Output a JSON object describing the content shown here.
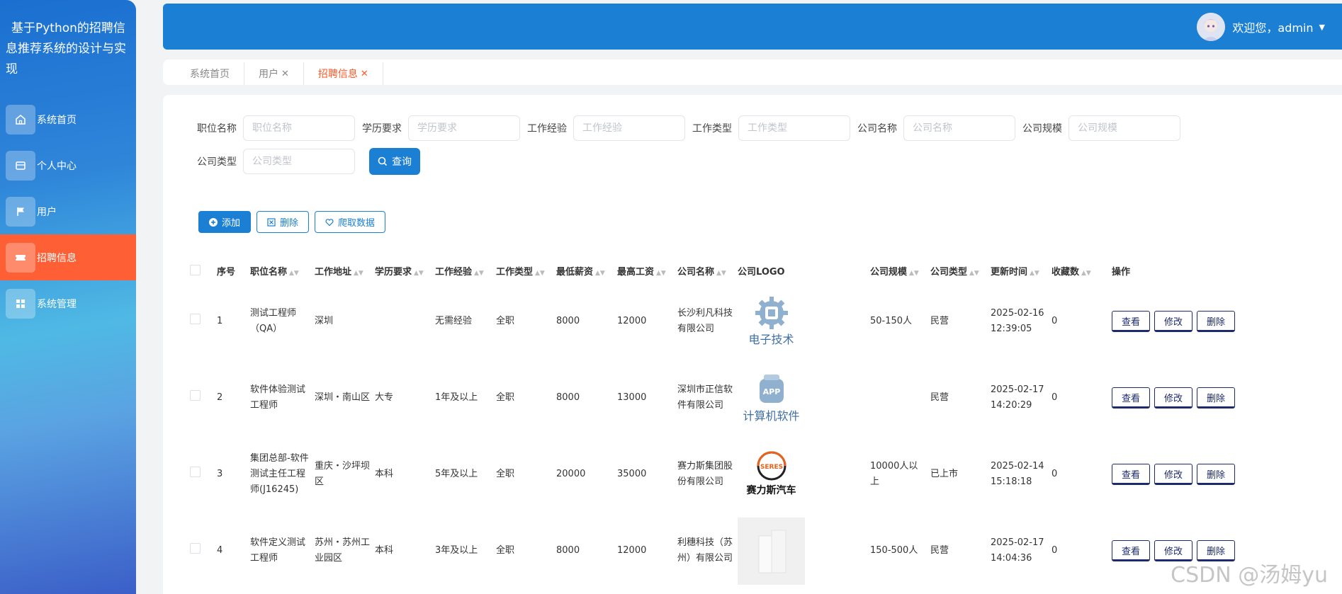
{
  "app": {
    "title": "基于Python的招聘信息推荐系统的设计与实现"
  },
  "sidebar": {
    "items": [
      {
        "label": "系统首页",
        "icon": "home-icon",
        "active": false
      },
      {
        "label": "个人中心",
        "icon": "card-icon",
        "active": false
      },
      {
        "label": "用户",
        "icon": "flag-icon",
        "active": false
      },
      {
        "label": "招聘信息",
        "icon": "ticket-icon",
        "active": true
      },
      {
        "label": "系统管理",
        "icon": "grid-icon",
        "active": false
      }
    ]
  },
  "header": {
    "welcome": "欢迎您，admin"
  },
  "tabs": [
    {
      "label": "系统首页",
      "closable": false,
      "active": false
    },
    {
      "label": "用户",
      "closable": true,
      "active": false
    },
    {
      "label": "招聘信息",
      "closable": true,
      "active": true
    }
  ],
  "filters": [
    {
      "label": "职位名称",
      "placeholder": "职位名称"
    },
    {
      "label": "学历要求",
      "placeholder": "学历要求"
    },
    {
      "label": "工作经验",
      "placeholder": "工作经验"
    },
    {
      "label": "工作类型",
      "placeholder": "工作类型"
    },
    {
      "label": "公司名称",
      "placeholder": "公司名称"
    },
    {
      "label": "公司规模",
      "placeholder": "公司规模"
    },
    {
      "label": "公司类型",
      "placeholder": "公司类型"
    }
  ],
  "search_button": "查询",
  "toolbar": {
    "add": "添加",
    "delete": "删除",
    "crawl": "爬取数据"
  },
  "table": {
    "columns": [
      "序号",
      "职位名称",
      "工作地址",
      "学历要求",
      "工作经验",
      "工作类型",
      "最低薪资",
      "最高工资",
      "公司名称",
      "公司LOGO",
      "公司规模",
      "公司类型",
      "更新时间",
      "收藏数",
      "操作"
    ],
    "row_actions": [
      "查看",
      "修改",
      "删除"
    ],
    "rows": [
      {
        "index": "1",
        "title": "测试工程师（QA）",
        "address": "深圳",
        "education": "",
        "experience": "无需经验",
        "type": "全职",
        "min_salary": "8000",
        "max_salary": "12000",
        "company": "长沙利凡科技有限公司",
        "logo_text": "电子技术",
        "logo_icon": "gear-chip-icon",
        "size": "50-150人",
        "company_type": "民营",
        "updated": "2025-02-16 12:39:05",
        "favorites": "0"
      },
      {
        "index": "2",
        "title": "软件体验测试工程师",
        "address": "深圳・南山区",
        "education": "大专",
        "experience": "1年及以上",
        "type": "全职",
        "min_salary": "8000",
        "max_salary": "13000",
        "company": "深圳市正信软件有限公司",
        "logo_text": "计算机软件",
        "logo_icon": "app-icon",
        "size": "",
        "company_type": "民营",
        "updated": "2025-02-17 14:20:29",
        "favorites": "0"
      },
      {
        "index": "3",
        "title": "集团总部-软件测试主任工程师(J16245)",
        "address": "重庆・沙坪坝区",
        "education": "本科",
        "experience": "5年及以上",
        "type": "全职",
        "min_salary": "20000",
        "max_salary": "35000",
        "company": "赛力斯集团股份有限公司",
        "logo_text": "赛力斯汽车",
        "logo_icon": "seres-logo-icon",
        "size": "10000人以上",
        "company_type": "已上市",
        "updated": "2025-02-14 15:18:18",
        "favorites": "0"
      },
      {
        "index": "4",
        "title": "软件定义测试工程师",
        "address": "苏州・苏州工业园区",
        "education": "本科",
        "experience": "3年及以上",
        "type": "全职",
        "min_salary": "8000",
        "max_salary": "12000",
        "company": "利穗科技（苏州）有限公司",
        "logo_text": "",
        "logo_icon": "building-icon",
        "size": "150-500人",
        "company_type": "民营",
        "updated": "2025-02-17 14:04:36",
        "favorites": "0"
      }
    ]
  },
  "watermark": "CSDN @汤姆yu",
  "colors": {
    "primary": "#1b7fd4",
    "active_menu": "#ff5f35",
    "active_tab": "#ff5a2a",
    "action_button_border": "#1d2a6b"
  }
}
